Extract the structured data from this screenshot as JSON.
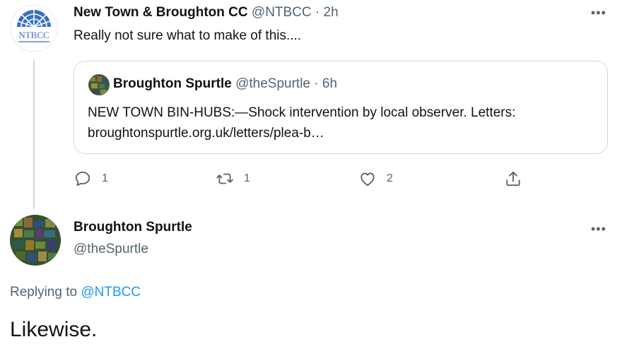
{
  "tweet": {
    "author_name": "New Town & Broughton CC",
    "author_handle": "@NTBCC",
    "time": "2h",
    "text": "Really not sure what to make of this....",
    "avatar_text": "NTBCC",
    "quote": {
      "author_name": "Broughton Spurtle",
      "author_handle": "@theSpurtle",
      "time": "6h",
      "text": "NEW TOWN BIN-HUBS:—Shock intervention by local observer. Letters: broughtonspurtle.org.uk/letters/plea-b…"
    },
    "actions": {
      "reply_count": "1",
      "retweet_count": "1",
      "like_count": "2"
    }
  },
  "reply_tweet": {
    "author_name": "Broughton Spurtle",
    "author_handle": "@theSpurtle",
    "replying_prefix": "Replying to",
    "replying_handle": "@NTBCC",
    "text": "Likewise."
  },
  "icons": {
    "more": "more-horizontal-icon",
    "reply": "reply-icon",
    "retweet": "retweet-icon",
    "like": "heart-icon",
    "share": "share-icon"
  },
  "colors": {
    "link": "#1d9bf0",
    "muted": "#536471",
    "border": "#cfd9de",
    "ntbcc_blue": "#3a6fc4"
  }
}
